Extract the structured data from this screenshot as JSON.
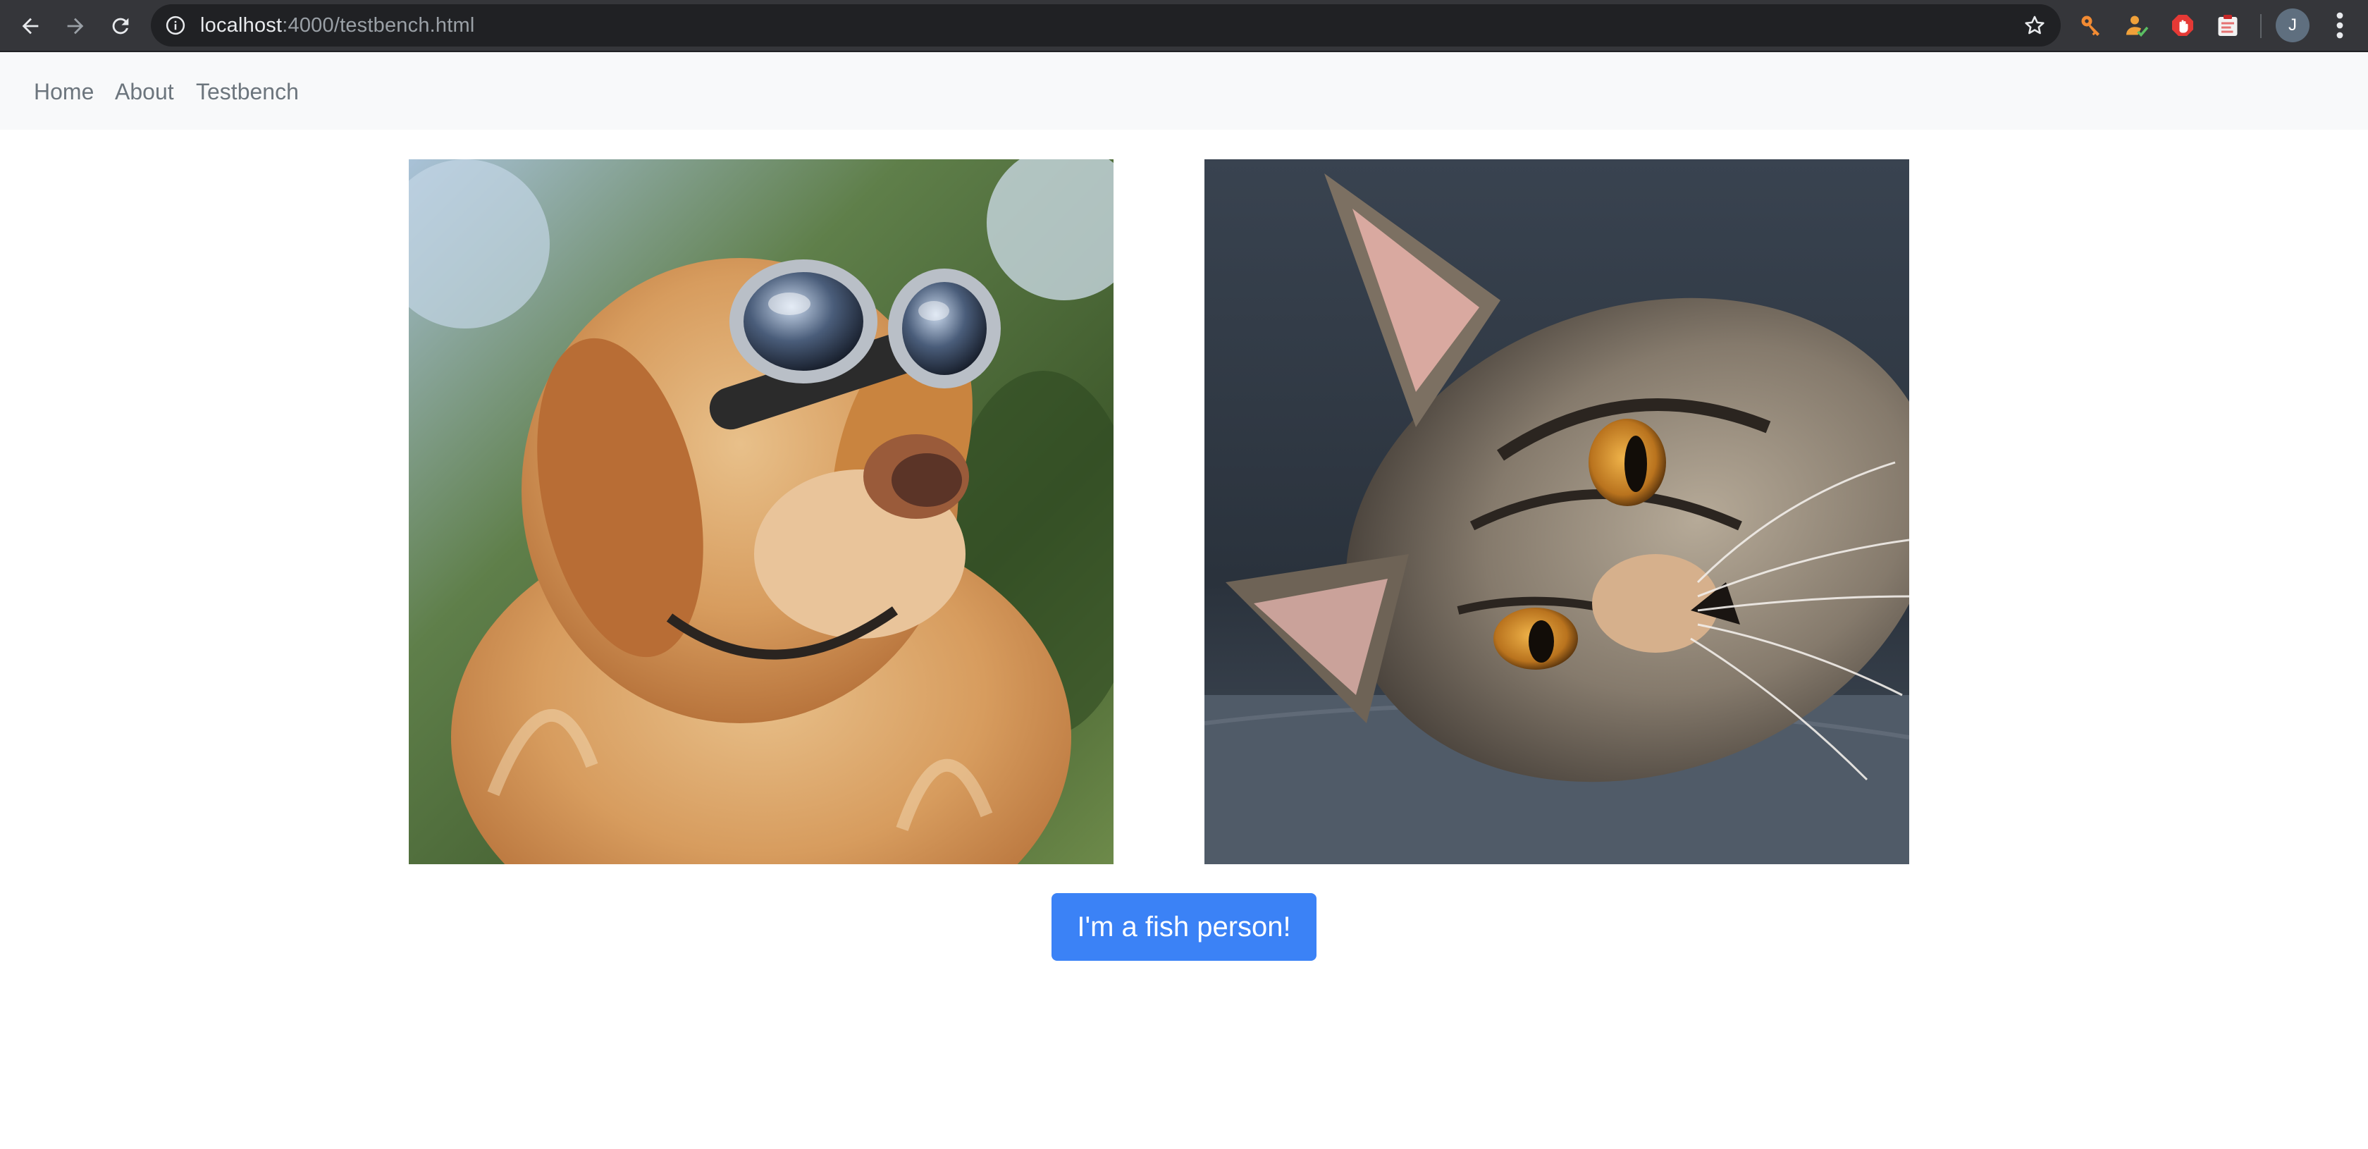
{
  "browser": {
    "url_host": "localhost",
    "url_rest": ":4000/testbench.html",
    "avatar_initial": "J",
    "icons": {
      "back": "back-arrow-icon",
      "forward": "forward-arrow-icon",
      "reload": "reload-icon",
      "site_info": "info-icon",
      "bookmark": "star-icon",
      "extensions": [
        "key-extension-icon",
        "person-check-extension-icon",
        "stop-hand-extension-icon",
        "clipboard-extension-icon"
      ],
      "menu": "kebab-menu-icon"
    }
  },
  "navbar": {
    "links": [
      "Home",
      "About",
      "Testbench"
    ],
    "background": "#f8f9fa",
    "link_color": "#6c757d"
  },
  "main": {
    "images": [
      {
        "subject": "dog",
        "alt": "Golden retriever wearing aviator goggles"
      },
      {
        "subject": "cat",
        "alt": "Tabby kitten resting its head on a gray couch"
      }
    ],
    "button": {
      "label": "I'm a fish person!",
      "color": "#3b82f6"
    }
  }
}
